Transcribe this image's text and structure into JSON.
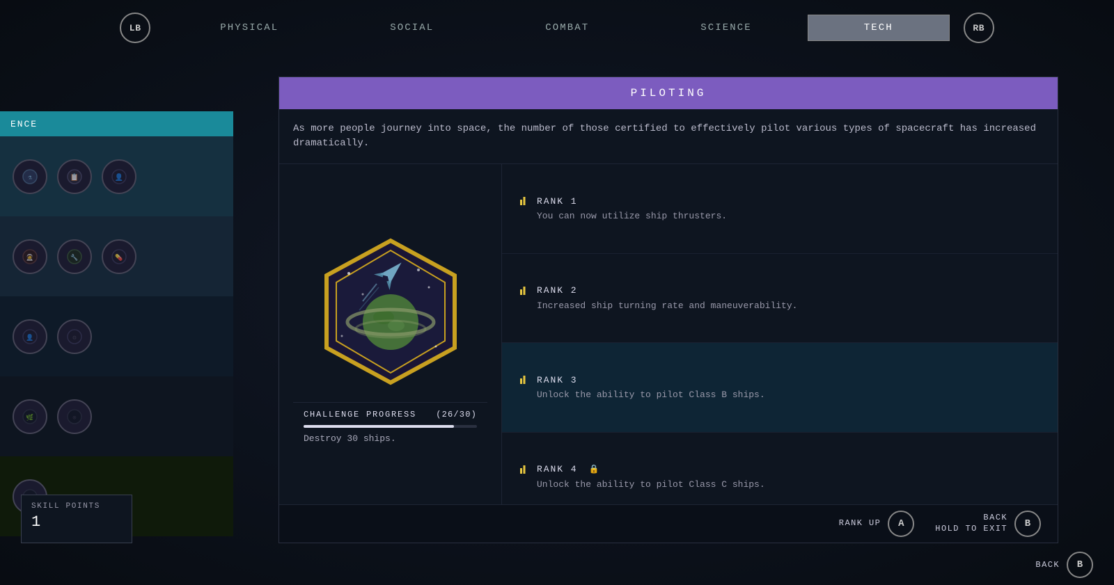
{
  "nav": {
    "left_button": "LB",
    "right_button": "RB",
    "tabs": [
      {
        "id": "physical",
        "label": "PHYSICAL",
        "active": false
      },
      {
        "id": "social",
        "label": "SOCIAL",
        "active": false
      },
      {
        "id": "combat",
        "label": "COMBAT",
        "active": false
      },
      {
        "id": "science",
        "label": "SCIENCE",
        "active": false
      },
      {
        "id": "tech",
        "label": "TECH",
        "active": true
      }
    ]
  },
  "sidebar": {
    "header_label": "ENCE",
    "rows": [
      {
        "id": "row1",
        "icons": 3
      },
      {
        "id": "row2",
        "icons": 3
      },
      {
        "id": "row3",
        "icons": 2
      },
      {
        "id": "row4",
        "icons": 2
      },
      {
        "id": "row5",
        "icons": 2
      }
    ]
  },
  "skill": {
    "title": "PILOTING",
    "description": "As more people journey into space, the number of those certified to effectively pilot various types of spacecraft has increased dramatically.",
    "badge_alt": "Piloting skill badge",
    "challenge": {
      "label": "CHALLENGE PROGRESS",
      "current": 26,
      "total": 30,
      "display": "(26/30)",
      "task": "Destroy 30 ships.",
      "progress_pct": 86.67
    },
    "ranks": [
      {
        "id": "rank1",
        "label": "RANK  1",
        "description": "You can now utilize ship thrusters.",
        "active": false,
        "locked": false
      },
      {
        "id": "rank2",
        "label": "RANK  2",
        "description": "Increased ship turning rate and maneuverability.",
        "active": false,
        "locked": false
      },
      {
        "id": "rank3",
        "label": "RANK  3",
        "description": "Unlock the ability to pilot Class B ships.",
        "active": true,
        "locked": false
      },
      {
        "id": "rank4",
        "label": "RANK  4",
        "description": "Unlock the ability to pilot Class C ships.",
        "active": false,
        "locked": true
      }
    ]
  },
  "actions": {
    "rank_up": {
      "label": "RANK UP",
      "button": "A"
    },
    "back": {
      "label": "BACK\nHOLD TO EXIT",
      "label_line1": "BACK",
      "label_line2": "HOLD TO EXIT",
      "button": "B"
    }
  },
  "skill_points": {
    "label": "SKILL POINTS",
    "value": "1"
  },
  "bottom_back": {
    "label": "BACK",
    "button": "B"
  }
}
